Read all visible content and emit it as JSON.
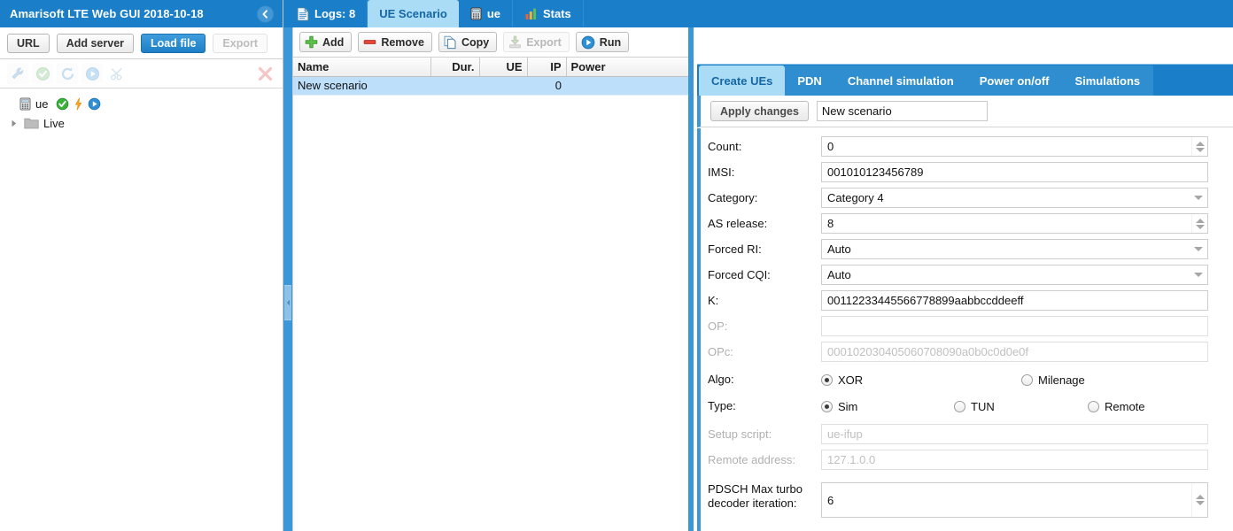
{
  "app": {
    "title": "Amarisoft LTE Web GUI 2018-10-18",
    "collapse_icon": "chevron-left-circle-icon"
  },
  "left_panel": {
    "buttons": [
      {
        "label": "URL",
        "state": "normal"
      },
      {
        "label": "Add server",
        "state": "normal"
      },
      {
        "label": "Load file",
        "state": "primary"
      },
      {
        "label": "Export",
        "state": "disabled"
      }
    ],
    "tools": [
      {
        "icon": "wrench-icon",
        "name": "configure-tool"
      },
      {
        "icon": "check-circle-icon",
        "name": "validate-tool"
      },
      {
        "icon": "refresh-icon",
        "name": "refresh-tool"
      },
      {
        "icon": "play-circle-icon",
        "name": "run-tool"
      },
      {
        "icon": "scissors-icon",
        "name": "cut-tool"
      },
      {
        "icon": "close-x-icon",
        "name": "delete-tool"
      }
    ],
    "tree": [
      {
        "label": "ue",
        "icon": "device-icon",
        "badges": [
          "check-circle-icon",
          "lightning-icon",
          "play-circle-icon"
        ],
        "expandable": false
      },
      {
        "label": "Live",
        "icon": "folder-icon",
        "badges": [],
        "expandable": true
      }
    ]
  },
  "main_tabs": [
    {
      "label": "Logs: 8",
      "icon": "document-icon",
      "active": false
    },
    {
      "label": "UE Scenario",
      "icon": "",
      "active": true
    },
    {
      "label": "ue",
      "icon": "device-icon",
      "active": false
    },
    {
      "label": "Stats",
      "icon": "bar-chart-icon",
      "active": false
    }
  ],
  "center_toolbar": [
    {
      "label": "Add",
      "icon": "plus-icon",
      "state": "normal"
    },
    {
      "label": "Remove",
      "icon": "minus-icon",
      "state": "normal"
    },
    {
      "label": "Copy",
      "icon": "copy-icon",
      "state": "normal"
    },
    {
      "label": "Export",
      "icon": "download-icon",
      "state": "disabled"
    },
    {
      "label": "Run",
      "icon": "play-circle-icon",
      "state": "normal"
    }
  ],
  "scenario_table": {
    "columns": [
      "Name",
      "Dur.",
      "UE",
      "IP",
      "Power"
    ],
    "rows": [
      {
        "name": "New scenario",
        "dur": "",
        "ue": "",
        "ip": "0",
        "power": "",
        "selected": true
      }
    ]
  },
  "right_tabs": [
    {
      "label": "Create UEs",
      "active": true
    },
    {
      "label": "PDN",
      "active": false
    },
    {
      "label": "Channel simulation",
      "active": false
    },
    {
      "label": "Power on/off",
      "active": false
    },
    {
      "label": "Simulations",
      "active": false
    }
  ],
  "apply_bar": {
    "button_label": "Apply changes",
    "scenario_name": "New scenario"
  },
  "form": {
    "count": {
      "label": "Count:",
      "value": "0",
      "type": "spinner"
    },
    "imsi": {
      "label": "IMSI:",
      "value": "001010123456789",
      "type": "text"
    },
    "category": {
      "label": "Category:",
      "value": "Category 4",
      "type": "select"
    },
    "as_release": {
      "label": "AS release:",
      "value": "8",
      "type": "spinner"
    },
    "forced_ri": {
      "label": "Forced RI:",
      "value": "Auto",
      "type": "select"
    },
    "forced_cqi": {
      "label": "Forced CQI:",
      "value": "Auto",
      "type": "select"
    },
    "k": {
      "label": "K:",
      "value": "00112233445566778899aabbccddeeff",
      "type": "text"
    },
    "op": {
      "label": "OP:",
      "value": "",
      "placeholder": "",
      "type": "text",
      "disabled": true
    },
    "opc": {
      "label": "OPc:",
      "value": "",
      "placeholder": "000102030405060708090a0b0c0d0e0f",
      "type": "text",
      "disabled": true
    },
    "algo": {
      "label": "Algo:",
      "options": [
        {
          "label": "XOR",
          "selected": true
        },
        {
          "label": "Milenage",
          "selected": false
        }
      ]
    },
    "type": {
      "label": "Type:",
      "options": [
        {
          "label": "Sim",
          "selected": true
        },
        {
          "label": "TUN",
          "selected": false
        },
        {
          "label": "Remote",
          "selected": false
        }
      ]
    },
    "setup_script": {
      "label": "Setup script:",
      "value": "",
      "placeholder": "ue-ifup",
      "type": "text",
      "disabled": true
    },
    "remote_address": {
      "label": "Remote address:",
      "value": "",
      "placeholder": "127.1.0.0",
      "type": "text",
      "disabled": true
    },
    "pdsch_max_turbo": {
      "label": "PDSCH Max turbo decoder iteration:",
      "value": "6",
      "type": "spinner"
    }
  },
  "colors": {
    "header_blue": "#1a7ec8",
    "tab_active_bg": "#aadcf6",
    "tab_active_text": "#1567a5",
    "splitter": "#3c97d9",
    "row_selected": "#bddffa"
  }
}
